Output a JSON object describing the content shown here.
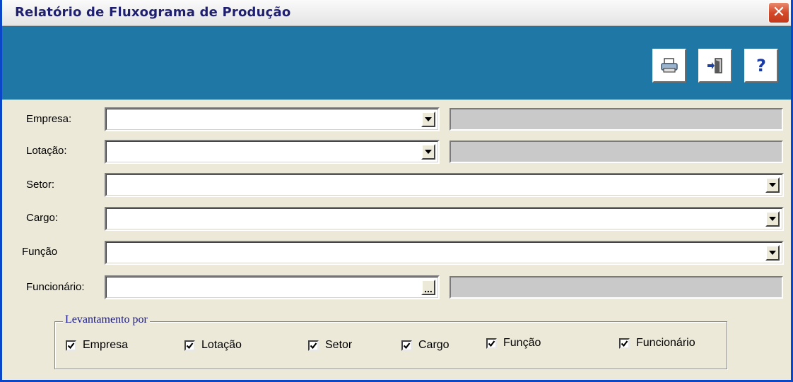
{
  "window": {
    "title": "Relatório de Fluxograma de Produção",
    "close_label": "✕"
  },
  "toolbar": {
    "buttons": [
      {
        "name": "print",
        "icon": "printer-icon"
      },
      {
        "name": "exit",
        "icon": "exit-door-icon"
      },
      {
        "name": "help",
        "icon": "help-icon",
        "label": "?"
      }
    ]
  },
  "form": {
    "empresa_label": "Empresa:",
    "empresa_value": "",
    "lotacao_label": "Lotação:",
    "lotacao_value": "",
    "setor_label": "Setor:",
    "setor_value": "",
    "cargo_label": "Cargo:",
    "cargo_value": "",
    "funcao_label": "Função",
    "funcao_value": "",
    "funcionario_label": "Funcionário:",
    "funcionario_value": "",
    "funcionario_button": "..."
  },
  "levantamento": {
    "legend": "Levantamento por",
    "options": [
      {
        "label": "Empresa",
        "checked": true
      },
      {
        "label": "Lotação",
        "checked": true
      },
      {
        "label": "Setor",
        "checked": true
      },
      {
        "label": "Cargo",
        "checked": true
      },
      {
        "label": "Função",
        "checked": true
      },
      {
        "label": "Funcionário",
        "checked": true
      }
    ]
  },
  "colors": {
    "toolbar_bg": "#1e77a4",
    "form_bg": "#ece9d8",
    "close_button": "#d4492a",
    "legend_text": "#1a1a8c"
  }
}
